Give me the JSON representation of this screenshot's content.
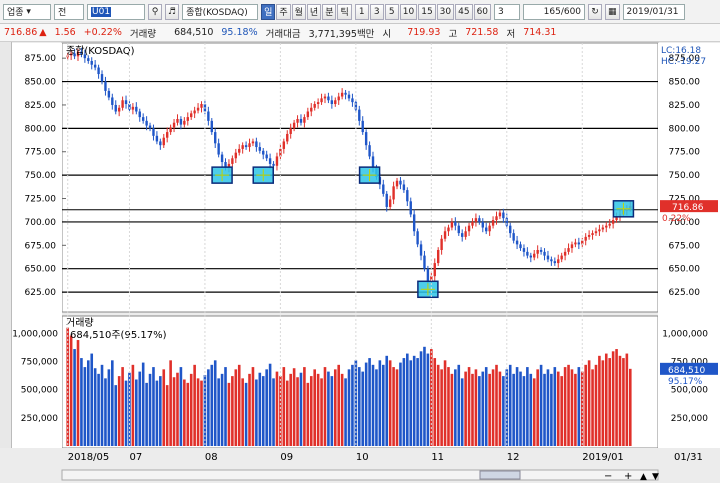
{
  "toolbar": {
    "sector": "업종",
    "type": "전",
    "code": "U01",
    "search_icon": "magnifier-icon",
    "sound_icon": "speaker-icon",
    "name": "종합(KOSDAQ)",
    "periods": [
      "일",
      "주",
      "월",
      "년",
      "분",
      "틱"
    ],
    "active_period": "일",
    "intervals": [
      "1",
      "3",
      "5",
      "10",
      "15",
      "30",
      "45",
      "60"
    ],
    "interval_value": "3",
    "count": "165/600",
    "date": "2019/01/31"
  },
  "info": {
    "last": "716.86",
    "arrow": "▲",
    "change": "1.56",
    "change_pct": "+0.22%",
    "volume_label": "거래량",
    "volume": "684,510",
    "volume_pct": "95.18%",
    "amount_label": "거래대금",
    "amount": "3,771,395백만",
    "open_label": "시",
    "open": "719.93",
    "high_label": "고",
    "high": "721.58",
    "low_label": "저",
    "low": "714.31"
  },
  "buttons": {
    "buy": "매수",
    "sell": "매도"
  },
  "price_panel": {
    "title": "종합(KOSDAQ)",
    "lc": "LC:16.18",
    "hc": "HC:-19.27",
    "current_label": "716.86",
    "current_pct": "0.22%"
  },
  "volume_panel": {
    "title": "거래량",
    "value_text": "684,510주(95.17%)",
    "current_label": "684,510",
    "current_pct": "95.17%"
  },
  "date_labels": [
    "2018/05",
    "07",
    "08",
    "09",
    "10",
    "11",
    "12",
    "2019/01"
  ],
  "corner_date": "01/31",
  "chart_data": {
    "type": "candlestick",
    "title": "종합(KOSDAQ)",
    "y_ticks": [
      "875.00",
      "850.00",
      "825.00",
      "800.00",
      "775.00",
      "750.00",
      "725.00",
      "700.00",
      "675.00",
      "650.00",
      "625.00"
    ],
    "ylim": [
      608,
      888
    ],
    "horizontal_lines": [
      850,
      800,
      750,
      700,
      650,
      625
    ],
    "close": [
      878,
      880,
      877,
      882,
      879,
      875,
      872,
      868,
      865,
      858,
      850,
      840,
      833,
      825,
      818,
      822,
      830,
      826,
      820,
      823,
      818,
      812,
      808,
      803,
      800,
      792,
      786,
      782,
      790,
      796,
      801,
      806,
      810,
      804,
      808,
      812,
      816,
      819,
      822,
      826,
      818,
      808,
      796,
      784,
      772,
      764,
      758,
      762,
      768,
      774,
      778,
      782,
      780,
      784,
      786,
      780,
      776,
      772,
      768,
      762,
      760,
      770,
      778,
      786,
      794,
      800,
      806,
      810,
      806,
      812,
      818,
      822,
      826,
      828,
      832,
      834,
      830,
      826,
      830,
      834,
      838,
      836,
      832,
      828,
      820,
      808,
      796,
      782,
      770,
      758,
      748,
      740,
      730,
      716,
      724,
      738,
      744,
      740,
      734,
      722,
      708,
      690,
      676,
      664,
      650,
      636,
      642,
      656,
      670,
      682,
      690,
      694,
      700,
      696,
      688,
      684,
      690,
      696,
      700,
      704,
      700,
      694,
      690,
      696,
      702,
      706,
      710,
      704,
      696,
      688,
      680,
      676,
      672,
      668,
      664,
      662,
      666,
      670,
      668,
      664,
      660,
      658,
      656,
      660,
      664,
      668,
      672,
      676,
      678,
      676,
      680,
      684,
      686,
      688,
      690,
      692,
      694,
      696,
      698,
      702,
      706,
      708,
      712,
      714,
      716.86
    ],
    "volume_ylim": [
      0,
      1100000
    ],
    "volume_ticks": [
      "1,000,000",
      "750,000",
      "500,000",
      "250,000"
    ],
    "volume": [
      1050000,
      980000,
      860000,
      940000,
      780000,
      700000,
      760000,
      820000,
      690000,
      640000,
      720000,
      600000,
      680000,
      760000,
      540000,
      620000,
      700000,
      580000,
      650000,
      720000,
      590000,
      660000,
      740000,
      560000,
      640000,
      700000,
      580000,
      620000,
      680000,
      540000,
      760000,
      610000,
      650000,
      700000,
      590000,
      560000,
      640000,
      720000,
      600000,
      580000,
      630000,
      680000,
      720000,
      760000,
      600000,
      640000,
      700000,
      560000,
      620000,
      680000,
      720000,
      600000,
      560000,
      640000,
      700000,
      590000,
      650000,
      620000,
      680000,
      730000,
      600000,
      660000,
      620000,
      700000,
      580000,
      640000,
      690000,
      610000,
      650000,
      700000,
      560000,
      620000,
      680000,
      640000,
      600000,
      700000,
      660000,
      620000,
      680000,
      720000,
      640000,
      600000,
      680000,
      720000,
      760000,
      700000,
      660000,
      740000,
      780000,
      720000,
      680000,
      760000,
      720000,
      800000,
      760000,
      700000,
      680000,
      740000,
      780000,
      820000,
      760000,
      800000,
      780000,
      840000,
      880000,
      820000,
      860000,
      780000,
      720000,
      680000,
      760000,
      700000,
      640000,
      680000,
      720000,
      600000,
      660000,
      700000,
      640000,
      680000,
      620000,
      660000,
      700000,
      640000,
      680000,
      720000,
      660000,
      620000,
      680000,
      720000,
      640000,
      700000,
      660000,
      620000,
      700000,
      640000,
      600000,
      680000,
      720000,
      640000,
      680000,
      640000,
      700000,
      660000,
      620000,
      700000,
      720000,
      680000,
      640000,
      700000,
      660000,
      720000,
      760000,
      680000,
      720000,
      800000,
      760000,
      820000,
      780000,
      840000,
      860000,
      800000,
      780000,
      820000,
      684510
    ],
    "highlight_boxes": [
      {
        "index": 45,
        "price": 750
      },
      {
        "index": 57,
        "price": 750
      },
      {
        "index": 88,
        "price": 750
      },
      {
        "index": 105,
        "price": 628
      },
      {
        "index": 162,
        "price": 714
      }
    ]
  }
}
